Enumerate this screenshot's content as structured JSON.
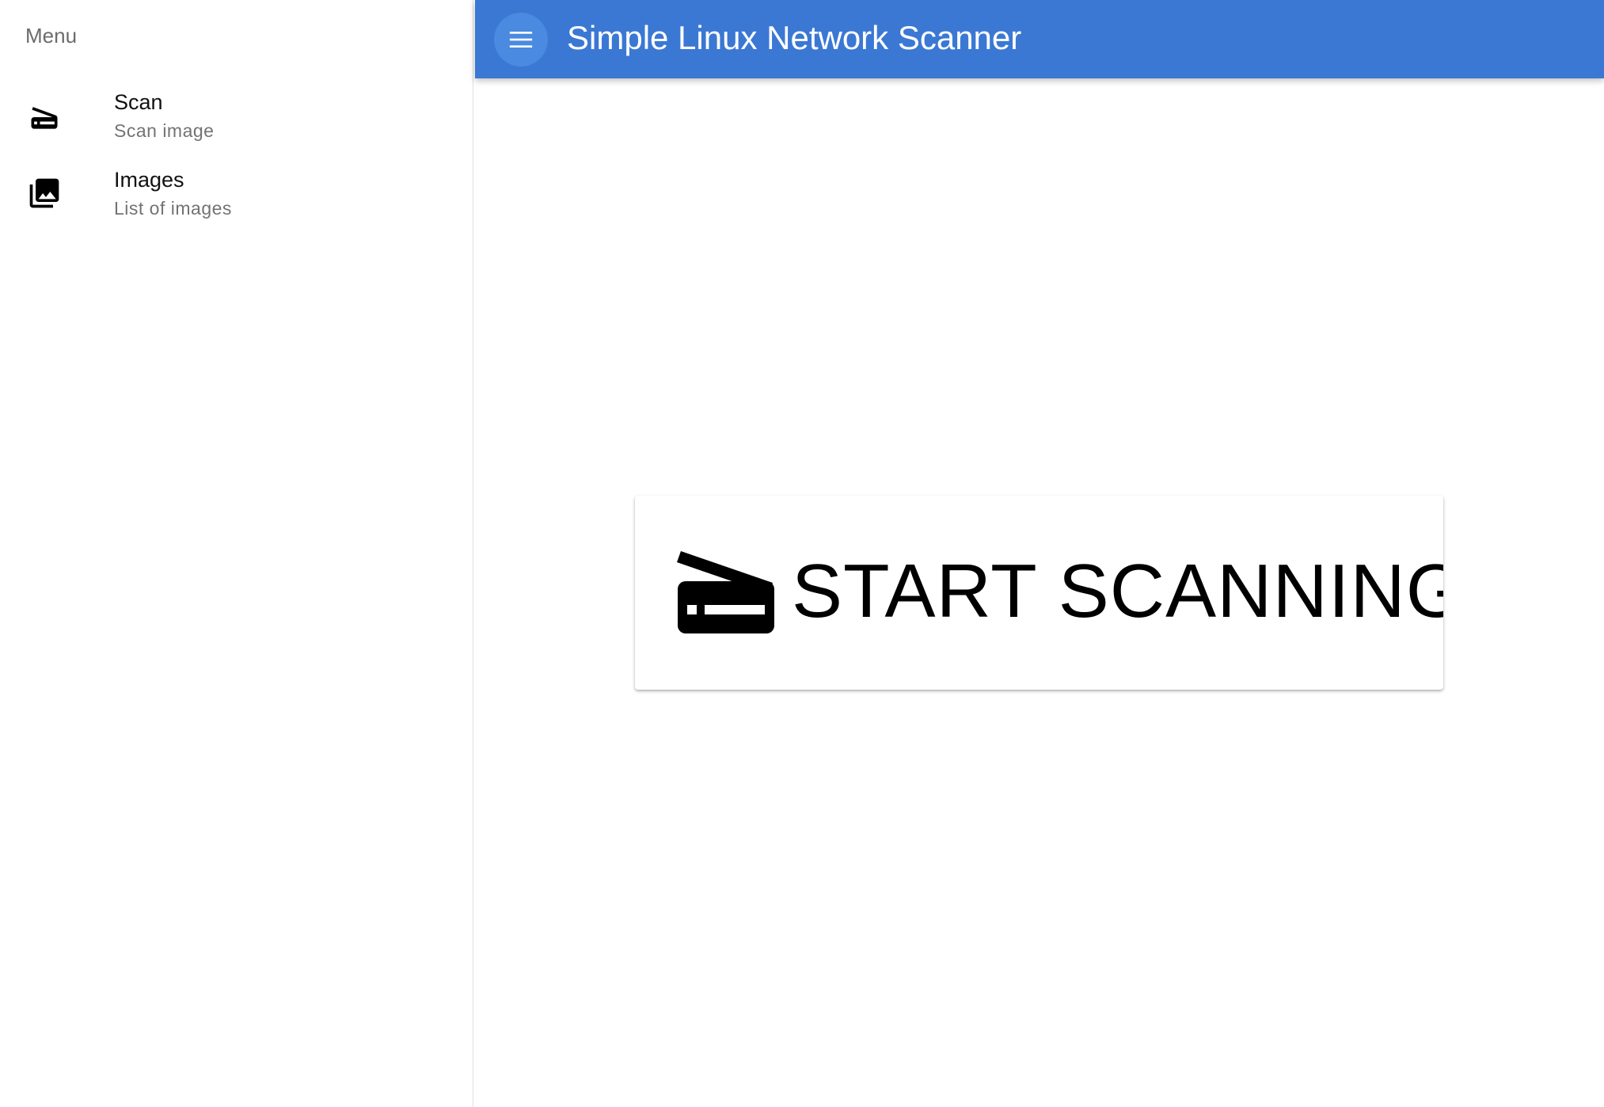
{
  "drawer": {
    "header": "Menu",
    "items": [
      {
        "icon": "scanner-icon",
        "title": "Scan",
        "subtitle": "Scan image"
      },
      {
        "icon": "photo-library-icon",
        "title": "Images",
        "subtitle": "List of images"
      }
    ]
  },
  "appbar": {
    "menu_icon": "hamburger-menu-icon",
    "title": "Simple Linux Network Scanner",
    "color": "#3b78d4"
  },
  "main": {
    "start_button": {
      "icon": "scanner-icon",
      "label": "START SCANNING"
    }
  }
}
